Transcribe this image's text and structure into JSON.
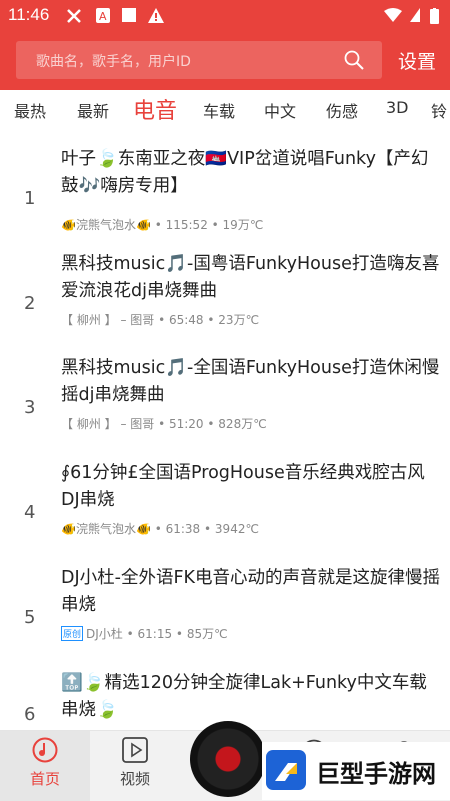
{
  "status_bar": {
    "time": "11:46"
  },
  "search": {
    "placeholder": "歌曲名，歌手名，用户ID",
    "settings_label": "设置"
  },
  "tabs": [
    {
      "label": "最热",
      "active": false
    },
    {
      "label": "最新",
      "active": false
    },
    {
      "label": "电音",
      "active": true
    },
    {
      "label": "车载",
      "active": false
    },
    {
      "label": "中文",
      "active": false
    },
    {
      "label": "伤感",
      "active": false
    },
    {
      "label": "3D",
      "active": false
    },
    {
      "label": "铃",
      "active": false
    }
  ],
  "songs": [
    {
      "rank": "1",
      "title": "叶子🍃东南亚之夜🇰🇭VIP岔道说唱Funky【产幻鼓🎶嗨房专用】",
      "author": "🐠浣熊气泡水🐠",
      "badge": "",
      "duration": "115:52",
      "plays": "19万℃"
    },
    {
      "rank": "2",
      "title": "黑科技music🎵-国粤语FunkyHouse打造嗨友喜爱流浪花dj串烧舞曲",
      "author": "【 柳州 】 – 图哥",
      "badge": "",
      "duration": "65:48",
      "plays": "23万℃"
    },
    {
      "rank": "3",
      "title": "黑科技music🎵-全国语FunkyHouse打造休闲慢摇dj串烧舞曲",
      "author": "【 柳州 】 – 图哥",
      "badge": "",
      "duration": "51:20",
      "plays": "828万℃"
    },
    {
      "rank": "4",
      "title": "∮61分钟£全国语ProgHouse音乐经典戏腔古风DJ串烧",
      "author": "🐠浣熊气泡水🐠",
      "badge": "",
      "duration": "61:38",
      "plays": "3942℃"
    },
    {
      "rank": "5",
      "title": "DJ小杜-全外语FK电音心动的声音就是这旋律慢摇串烧",
      "author": "DJ小杜",
      "badge": "原创",
      "duration": "61:15",
      "plays": "85万℃"
    },
    {
      "rank": "6",
      "title": "🔝🍃精选120分钟全旋律Lak+Funky中文车载串烧🍃",
      "author": "",
      "badge": "",
      "duration": "",
      "plays": ""
    }
  ],
  "bottom_nav": [
    {
      "label": "首页",
      "icon": "music-note-icon",
      "active": true
    },
    {
      "label": "视频",
      "icon": "play-icon",
      "active": false
    }
  ],
  "watermark": {
    "text": "巨型手游网"
  },
  "colors": {
    "primary": "#e8423c",
    "nav_bg": "#f2f2f2"
  }
}
